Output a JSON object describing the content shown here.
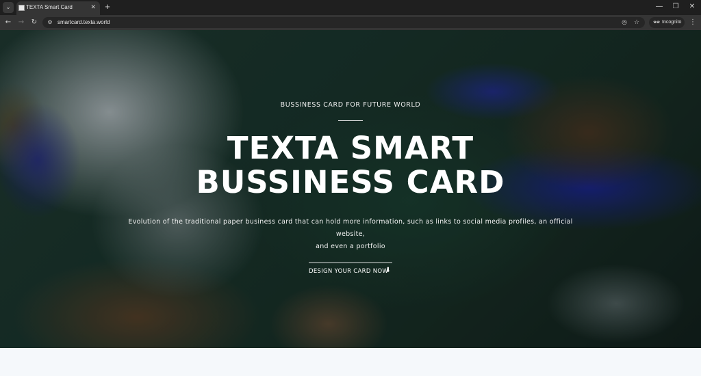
{
  "browser": {
    "tab": {
      "title": "TEXTA Smart Card",
      "close_glyph": "✕"
    },
    "new_tab_glyph": "+",
    "tab_search_glyph": "⌄",
    "window": {
      "minimize": "—",
      "restore": "❐",
      "close": "✕"
    },
    "nav": {
      "back": "←",
      "forward": "→",
      "reload": "↻"
    },
    "address": {
      "url": "smartcard.texta.world",
      "site_info_glyph": "⚙"
    },
    "icons": {
      "eye_off": "◎",
      "star": "☆",
      "menu": "⋮",
      "incognito": "🕶"
    },
    "incognito_label": "Incognito"
  },
  "hero": {
    "eyebrow": "BUSSINESS CARD FOR FUTURE WORLD",
    "headline_line1": "TEXTA SMART",
    "headline_line2": "BUSSINESS CARD",
    "description_line1": "Evolution of the traditional paper business card that can hold more information, such as links to social media profiles, an official website,",
    "description_line2": "and even a portfolio",
    "cta_label": "DESIGN YOUR CARD NOW",
    "cta_arrow": "⬇"
  }
}
